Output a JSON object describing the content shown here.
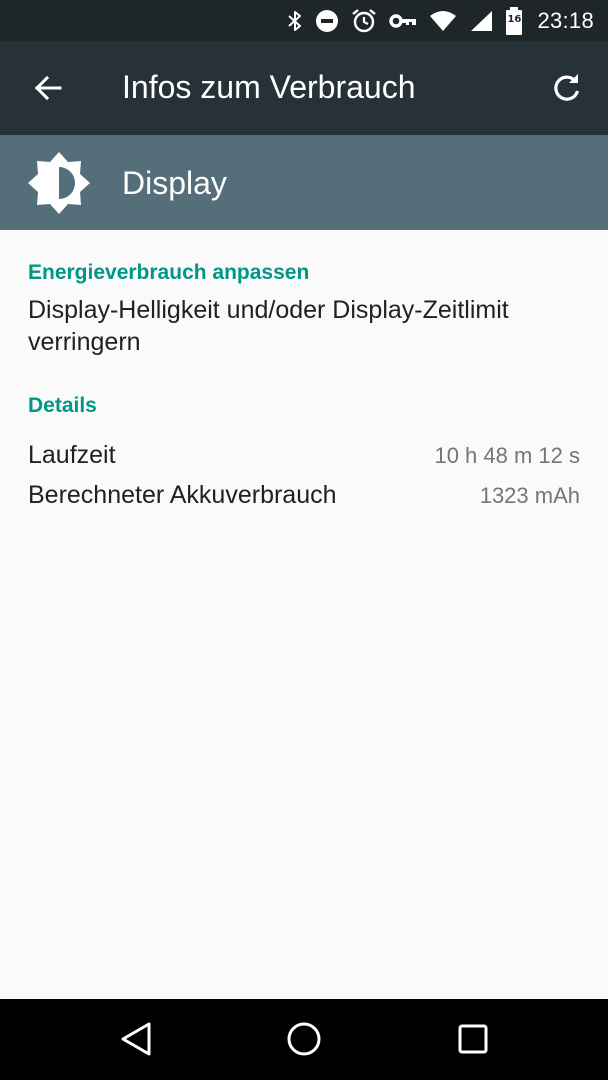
{
  "status_bar": {
    "icons": [
      "bluetooth-icon",
      "do-not-disturb-icon",
      "alarm-icon",
      "vpn-key-icon",
      "wifi-icon",
      "cell-signal-icon",
      "battery-icon"
    ],
    "battery_level": "16",
    "time": "23:18"
  },
  "app_bar": {
    "back_icon": "arrow-back-icon",
    "title": "Infos zum Verbrauch",
    "refresh_icon": "refresh-icon"
  },
  "header": {
    "icon": "brightness-icon",
    "title": "Display"
  },
  "content": {
    "tip_title": "Energieverbrauch anpassen",
    "tip_text": "Display-Helligkeit und/oder Display-Zeitlimit verringern",
    "details_title": "Details",
    "details": [
      {
        "label": "Laufzeit",
        "value": "10 h 48 m 12 s"
      },
      {
        "label": "Berechneter Akkuverbrauch",
        "value": "1323 mAh"
      }
    ]
  },
  "nav_bar": {
    "icons": [
      "nav-back-icon",
      "nav-home-icon",
      "nav-recents-icon"
    ]
  },
  "colors": {
    "status_bar": "#1e262a",
    "app_bar": "#263238",
    "header_band": "#546e7a",
    "accent": "#009688",
    "background": "#fafafa"
  }
}
